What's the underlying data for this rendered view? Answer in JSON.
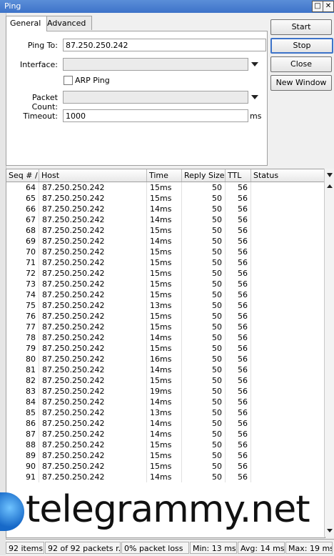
{
  "window": {
    "title": "Ping"
  },
  "tabs": [
    {
      "label": "General"
    },
    {
      "label": "Advanced"
    }
  ],
  "form": {
    "ping_to_label": "Ping To:",
    "ping_to_value": "87.250.250.242",
    "interface_label": "Interface:",
    "interface_value": "",
    "arp_ping_label": "ARP Ping",
    "packet_count_label": "Packet Count:",
    "packet_count_value": "",
    "timeout_label": "Timeout:",
    "timeout_value": "1000",
    "timeout_unit": "ms"
  },
  "buttons": {
    "start": "Start",
    "stop": "Stop",
    "close": "Close",
    "new_window": "New Window"
  },
  "table": {
    "columns": [
      "Seq # /",
      "Host",
      "Time",
      "Reply Size",
      "TTL",
      "Status"
    ],
    "rows": [
      {
        "seq": "64",
        "host": "87.250.250.242",
        "time": "15ms",
        "size": "50",
        "ttl": "56",
        "status": ""
      },
      {
        "seq": "65",
        "host": "87.250.250.242",
        "time": "15ms",
        "size": "50",
        "ttl": "56",
        "status": ""
      },
      {
        "seq": "66",
        "host": "87.250.250.242",
        "time": "14ms",
        "size": "50",
        "ttl": "56",
        "status": ""
      },
      {
        "seq": "67",
        "host": "87.250.250.242",
        "time": "14ms",
        "size": "50",
        "ttl": "56",
        "status": ""
      },
      {
        "seq": "68",
        "host": "87.250.250.242",
        "time": "15ms",
        "size": "50",
        "ttl": "56",
        "status": ""
      },
      {
        "seq": "69",
        "host": "87.250.250.242",
        "time": "14ms",
        "size": "50",
        "ttl": "56",
        "status": ""
      },
      {
        "seq": "70",
        "host": "87.250.250.242",
        "time": "15ms",
        "size": "50",
        "ttl": "56",
        "status": ""
      },
      {
        "seq": "71",
        "host": "87.250.250.242",
        "time": "15ms",
        "size": "50",
        "ttl": "56",
        "status": ""
      },
      {
        "seq": "72",
        "host": "87.250.250.242",
        "time": "15ms",
        "size": "50",
        "ttl": "56",
        "status": ""
      },
      {
        "seq": "73",
        "host": "87.250.250.242",
        "time": "15ms",
        "size": "50",
        "ttl": "56",
        "status": ""
      },
      {
        "seq": "74",
        "host": "87.250.250.242",
        "time": "15ms",
        "size": "50",
        "ttl": "56",
        "status": ""
      },
      {
        "seq": "75",
        "host": "87.250.250.242",
        "time": "13ms",
        "size": "50",
        "ttl": "56",
        "status": ""
      },
      {
        "seq": "76",
        "host": "87.250.250.242",
        "time": "15ms",
        "size": "50",
        "ttl": "56",
        "status": ""
      },
      {
        "seq": "77",
        "host": "87.250.250.242",
        "time": "15ms",
        "size": "50",
        "ttl": "56",
        "status": ""
      },
      {
        "seq": "78",
        "host": "87.250.250.242",
        "time": "14ms",
        "size": "50",
        "ttl": "56",
        "status": ""
      },
      {
        "seq": "79",
        "host": "87.250.250.242",
        "time": "15ms",
        "size": "50",
        "ttl": "56",
        "status": ""
      },
      {
        "seq": "80",
        "host": "87.250.250.242",
        "time": "16ms",
        "size": "50",
        "ttl": "56",
        "status": ""
      },
      {
        "seq": "81",
        "host": "87.250.250.242",
        "time": "14ms",
        "size": "50",
        "ttl": "56",
        "status": ""
      },
      {
        "seq": "82",
        "host": "87.250.250.242",
        "time": "15ms",
        "size": "50",
        "ttl": "56",
        "status": ""
      },
      {
        "seq": "83",
        "host": "87.250.250.242",
        "time": "19ms",
        "size": "50",
        "ttl": "56",
        "status": ""
      },
      {
        "seq": "84",
        "host": "87.250.250.242",
        "time": "14ms",
        "size": "50",
        "ttl": "56",
        "status": ""
      },
      {
        "seq": "85",
        "host": "87.250.250.242",
        "time": "13ms",
        "size": "50",
        "ttl": "56",
        "status": ""
      },
      {
        "seq": "86",
        "host": "87.250.250.242",
        "time": "14ms",
        "size": "50",
        "ttl": "56",
        "status": ""
      },
      {
        "seq": "87",
        "host": "87.250.250.242",
        "time": "14ms",
        "size": "50",
        "ttl": "56",
        "status": ""
      },
      {
        "seq": "88",
        "host": "87.250.250.242",
        "time": "15ms",
        "size": "50",
        "ttl": "56",
        "status": ""
      },
      {
        "seq": "89",
        "host": "87.250.250.242",
        "time": "15ms",
        "size": "50",
        "ttl": "56",
        "status": ""
      },
      {
        "seq": "90",
        "host": "87.250.250.242",
        "time": "15ms",
        "size": "50",
        "ttl": "56",
        "status": ""
      },
      {
        "seq": "91",
        "host": "87.250.250.242",
        "time": "14ms",
        "size": "50",
        "ttl": "56",
        "status": ""
      }
    ]
  },
  "watermark": {
    "text": "telegrammy.net"
  },
  "statusbar": {
    "items": "92 items",
    "packets": "92 of 92 packets r...",
    "loss": "0% packet loss",
    "min": "Min: 13 ms",
    "avg": "Avg: 14 ms",
    "max": "Max: 19 ms"
  },
  "colors": {
    "titlebar": "#3d73c9",
    "accent": "#3d73c9"
  }
}
